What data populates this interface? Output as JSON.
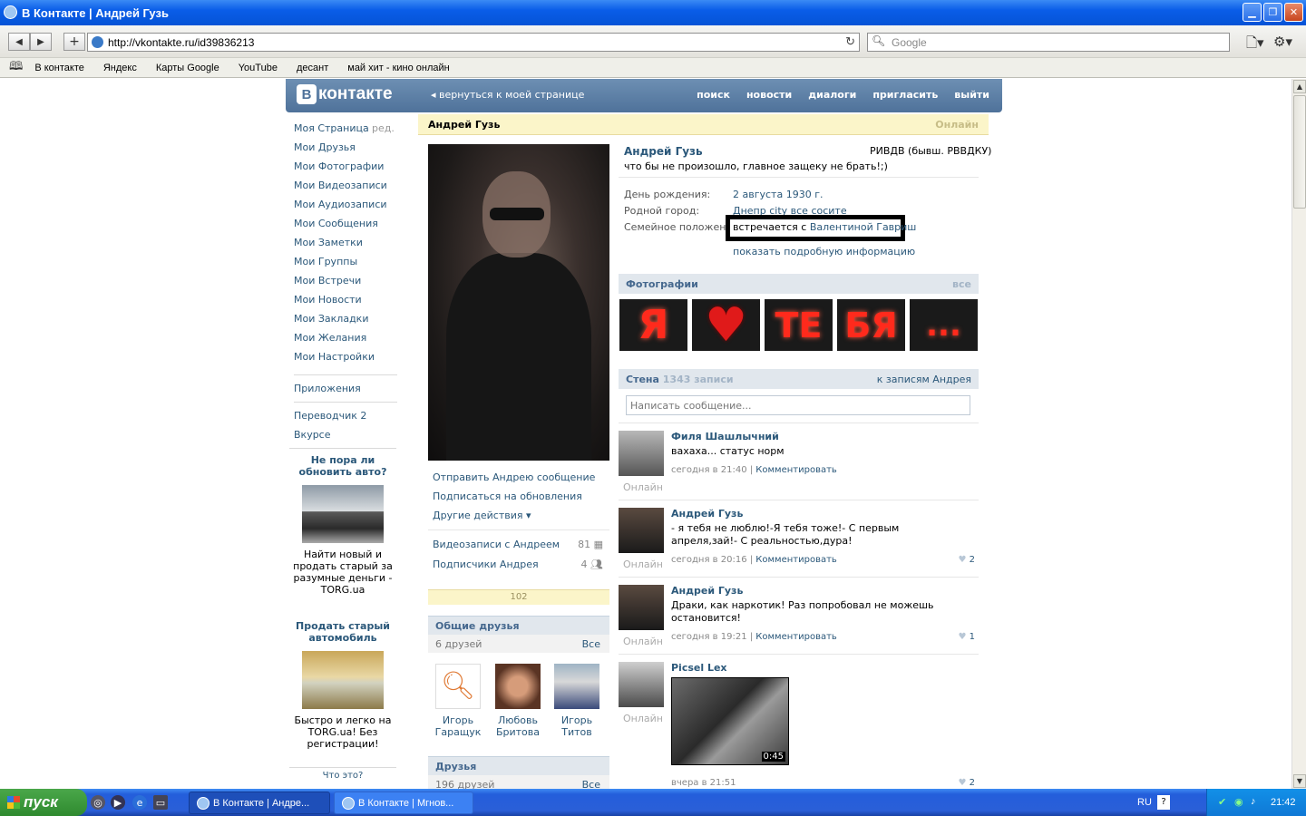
{
  "window": {
    "title": "В Контакте | Андрей Гузь"
  },
  "browser": {
    "url": "http://vkontakte.ru/id39836213",
    "search_placeholder": "Google",
    "bookmarks": [
      "В контакте",
      "Яндекс",
      "Карты Google",
      "YouTube",
      "десант",
      "май хит - кино онлайн"
    ]
  },
  "vk": {
    "logo": "контакте",
    "logo_b": "B",
    "back_link": "вернуться к моей странице",
    "topnav": [
      "поиск",
      "новости",
      "диалоги",
      "пригласить",
      "выйти"
    ]
  },
  "menu": {
    "items": [
      "Моя Страница",
      "Мои Друзья",
      "Мои Фотографии",
      "Мои Видеозаписи",
      "Мои Аудиозаписи",
      "Мои Сообщения",
      "Мои Заметки",
      "Мои Группы",
      "Мои Встречи",
      "Мои Новости",
      "Мои Закладки",
      "Мои Желания",
      "Мои Настройки"
    ],
    "edit": "ред.",
    "apps": "Приложения",
    "extras": [
      "Переводчик 2",
      "Вкурсе"
    ]
  },
  "ads": [
    {
      "title": "Не пора ли обновить авто?",
      "desc": "Найти новый и продать старый за разумные деньги - TORG.ua"
    },
    {
      "title": "Продать старый автомобиль",
      "desc": "Быстро и легко на TORG.ua! Без регистрации!"
    }
  ],
  "ads_what": "Что это?",
  "profile": {
    "header_name": "Андрей Гузь",
    "header_status": "Онлайн",
    "name": "Андрей Гузь",
    "status": "что бы не произошло, главное защеку не брать!;)",
    "school": "РИВДВ (бывш. РВВДКУ)",
    "birthday_label": "День рождения:",
    "birthday": "2 августа 1930 г.",
    "hometown_label": "Родной город:",
    "hometown": "Днепр city все сосите",
    "relation_label": "Семейное положение:",
    "relation_prefix": "встречается с",
    "relation_name": "Валентиной Гавриш",
    "show_more": "показать подробную информацию"
  },
  "actions": [
    "Отправить Андрею сообщение",
    "Подписаться на обновления",
    "Другие действия"
  ],
  "lists": [
    {
      "label": "Видеозаписи с Андреем",
      "count": "81"
    },
    {
      "label": "Подписчики Андрея",
      "count": "4"
    }
  ],
  "rating": "102",
  "common_friends": {
    "title": "Общие друзья",
    "count": "6 друзей",
    "all": "Все",
    "people": [
      {
        "first": "Игорь",
        "last": "Гаращук"
      },
      {
        "first": "Любовь",
        "last": "Бритова"
      },
      {
        "first": "Игорь",
        "last": "Титов"
      }
    ]
  },
  "friends": {
    "title": "Друзья",
    "count": "196 друзей",
    "all": "Все"
  },
  "photos": {
    "title": "Фотографии",
    "all": "все",
    "letters": [
      "Я",
      "♥",
      "ТЕ",
      "БЯ",
      "..."
    ]
  },
  "wall": {
    "title": "Стена",
    "count": "1343 записи",
    "link": "к записям Андрея",
    "placeholder": "Написать сообщение...",
    "comment": "Комментировать",
    "online": "Онлайн",
    "posts": [
      {
        "author": "Филя Шашлычний",
        "text": "вахаха... статус норм",
        "time": "сегодня в 21:40",
        "likes": ""
      },
      {
        "author": "Андрей Гузь",
        "text": "- я тебя не люблю!-Я тебя тоже!- С первым апреля,зай!- С реальностью,дура!",
        "time": "сегодня в 20:16",
        "likes": "2"
      },
      {
        "author": "Андрей Гузь",
        "text": "Драки, как наркотик! Раз попробовал не можешь остановится!",
        "time": "сегодня в 19:21",
        "likes": "1"
      },
      {
        "author": "Picsel Lex",
        "text": "",
        "time": "вчера в 21:51",
        "likes": "2",
        "video_duration": "0:45"
      }
    ]
  },
  "taskbar": {
    "start": "пуск",
    "tasks": [
      "В Контакте | Андре...",
      "В Контакте | Мгнов..."
    ],
    "lang": "RU",
    "time": "21:42"
  }
}
